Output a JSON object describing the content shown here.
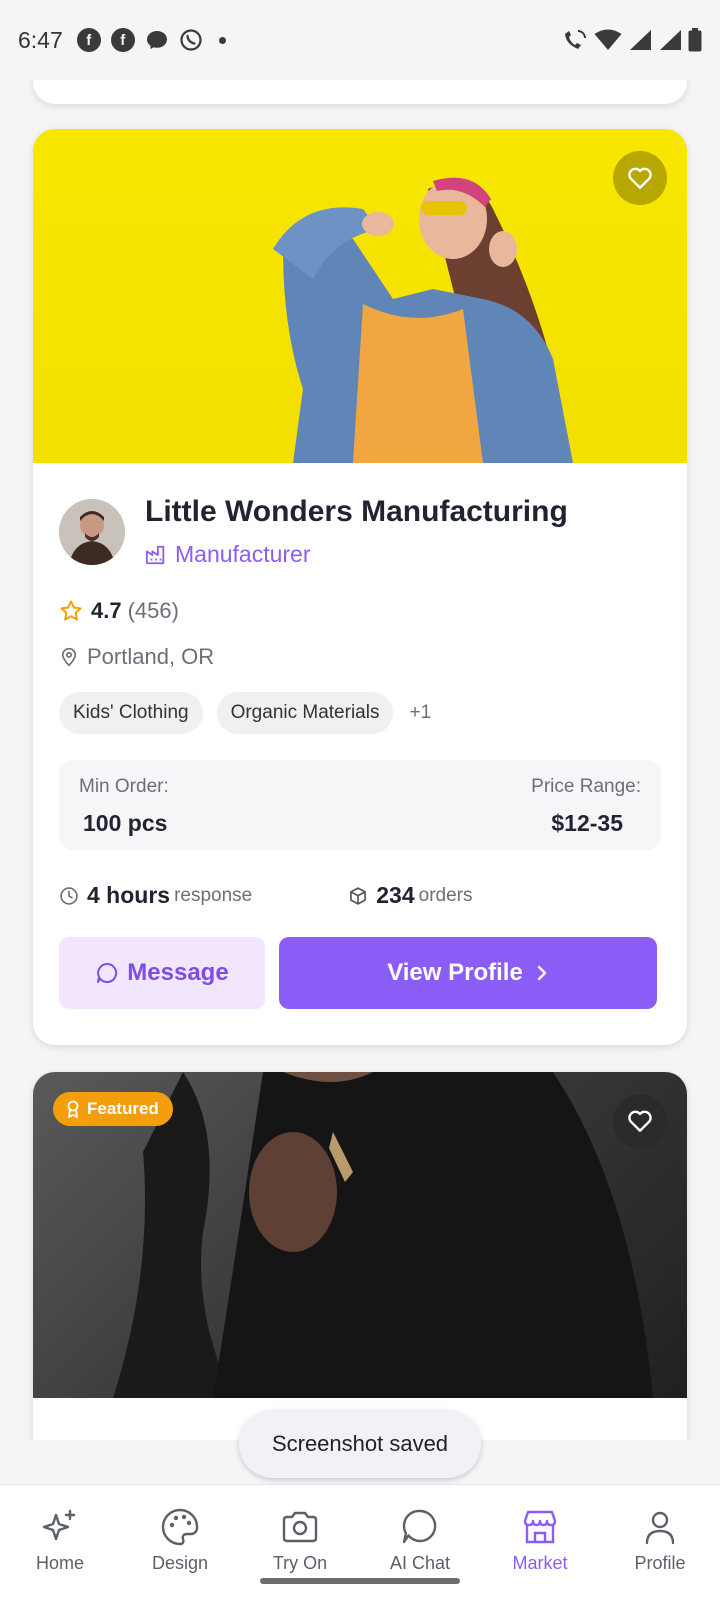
{
  "status_bar": {
    "time": "6:47"
  },
  "listing": {
    "company_name": "Little Wonders Manufacturing",
    "company_type": "Manufacturer",
    "rating": "4.7",
    "rating_count": "(456)",
    "location": "Portland, OR",
    "tags": [
      "Kids' Clothing",
      "Organic Materials"
    ],
    "more_tags": "+1",
    "min_order_label": "Min Order:",
    "min_order_value": "100 pcs",
    "price_range_label": "Price Range:",
    "price_range_value": "$12-35",
    "response_value": "4 hours",
    "response_label": "response",
    "orders_value": "234",
    "orders_label": "orders",
    "message_button": "Message",
    "view_profile_button": "View Profile"
  },
  "next_listing": {
    "featured_badge": "Featured"
  },
  "toast": {
    "text": "Screenshot saved"
  },
  "bottom_nav": {
    "items": [
      {
        "label": "Home",
        "icon": "sparkles-icon",
        "active": false
      },
      {
        "label": "Design",
        "icon": "palette-icon",
        "active": false
      },
      {
        "label": "Try On",
        "icon": "camera-icon",
        "active": false
      },
      {
        "label": "AI Chat",
        "icon": "chat-bubble-icon",
        "active": false
      },
      {
        "label": "Market",
        "icon": "store-icon",
        "active": true
      },
      {
        "label": "Profile",
        "icon": "user-icon",
        "active": false
      }
    ]
  },
  "colors": {
    "accent": "#8b5cf6",
    "accent_light": "#f1e6fd",
    "featured": "#f59e0b",
    "star": "#f59e0b"
  }
}
